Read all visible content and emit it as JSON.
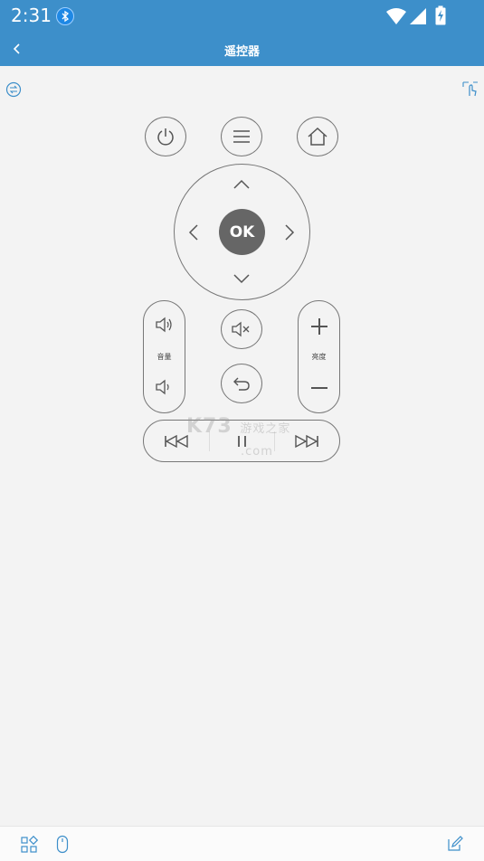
{
  "status_bar": {
    "time": "2:31"
  },
  "header": {
    "title": "遥控器"
  },
  "remote": {
    "ok_label": "OK",
    "volume_label": "音量",
    "brightness_label": "亮度"
  },
  "watermark": {
    "main": "K73",
    "sub": "游戏之家",
    "domain": ".com"
  },
  "colors": {
    "accent": "#3d8fca",
    "ok_button": "#666666",
    "outline": "#777777"
  }
}
